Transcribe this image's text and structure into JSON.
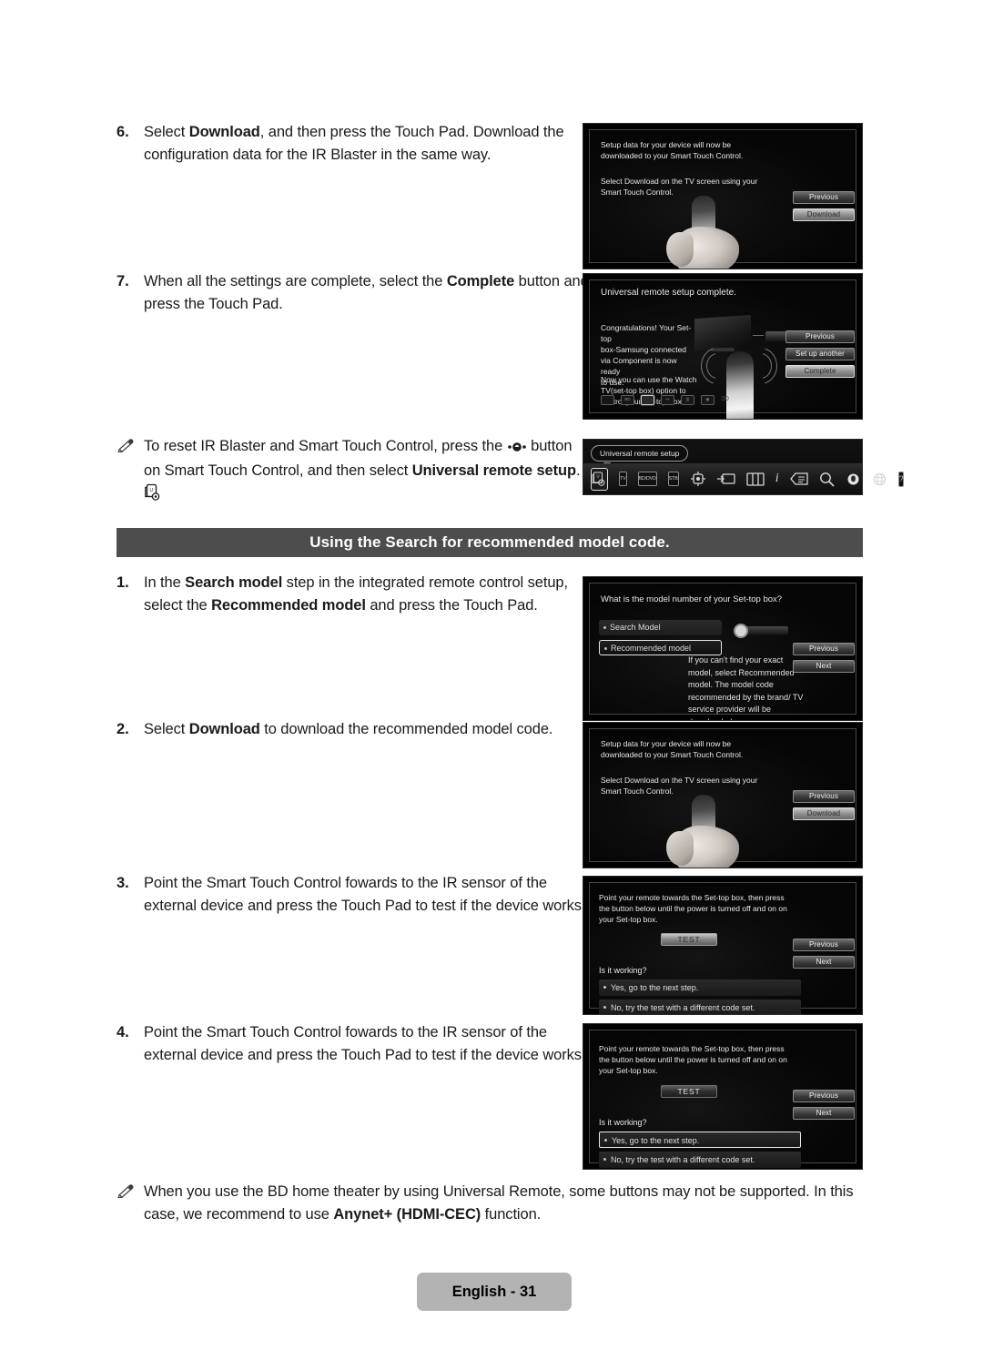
{
  "steps": {
    "s6": {
      "num": "6.",
      "p1": "Select ",
      "bold1": "Download",
      "p2": ", and then press the Touch Pad. Download the configuration data for the IR Blaster in the same way."
    },
    "s7": {
      "num": "7.",
      "p1": "When all the settings are complete, select the ",
      "bold1": "Complete",
      "p2": " button and press the Touch Pad."
    },
    "note1": {
      "p1": "To reset IR Blaster and Smart Touch Control, press the ",
      "icon1": "more-button-icon",
      "p2": " button on Smart Touch Control, and then select ",
      "bold1": "Universal remote setup",
      "p3": ".",
      "icon2": "universal-remote-setup-icon"
    },
    "s1": {
      "num": "1.",
      "p1": "In the ",
      "bold1": "Search model",
      "p2": " step in the integrated remote control setup, select the ",
      "bold2": "Recommended model",
      "p3": " and press the Touch Pad."
    },
    "s2": {
      "num": "2.",
      "p1": "Select ",
      "bold1": "Download",
      "p2": " to download the recommended model code."
    },
    "s3": {
      "num": "3.",
      "p1": "Point the Smart Touch Control fowards to the IR sensor of the external device and press the Touch Pad to test if the device works."
    },
    "s4": {
      "num": "4.",
      "p1": "Point the Smart Touch Control fowards to the IR sensor of the external device and press the Touch Pad to test if the device works."
    },
    "note2": {
      "p1": "When you use the BD home theater by using Universal Remote, some buttons may not be supported. In this case, we recommend to use ",
      "bold1": "Anynet+ (HDMI-CEC)",
      "p2": " function."
    }
  },
  "section_header": "Using the Search for recommended model code.",
  "footer": "English - 31",
  "shots": {
    "download1": {
      "line1": "Setup data for your device will now be",
      "line2": "downloaded to your Smart Touch Control.",
      "line3": "Select Download on the TV screen using your",
      "line4": "Smart Touch Control.",
      "btn_previous": "Previous",
      "btn_download": "Download"
    },
    "complete": {
      "title": "Universal remote setup complete.",
      "line1": "Congratulations! Your Set-top",
      "line2": "box-Samsung connected",
      "line3": "via Component is now ready",
      "line4": "to use.",
      "line5": "Now you can use the Watch",
      "line6": "TV(set-top box) option to",
      "line7": "control your set-top box",
      "btn_previous": "Previous",
      "btn_setup_another": "Set up another",
      "btn_complete": "Complete",
      "source_icons": [
        "tv-icon",
        "bd-dvd-icon",
        "set-top-box-icon",
        "source-input-icon",
        "channel-list-icon",
        "recording-icon"
      ],
      "badge_3d": "3D"
    },
    "menubar": {
      "tooltip": "Universal remote setup",
      "icons": [
        {
          "name": "universal-remote-setup-icon",
          "label": ""
        },
        {
          "name": "tv-icon",
          "label": "TV"
        },
        {
          "name": "bd-dvd-icon",
          "label": "BD/DVD"
        },
        {
          "name": "stb-icon",
          "label": "STB"
        },
        {
          "name": "smart-hub-icon",
          "label": ""
        },
        {
          "name": "source-icon",
          "label": ""
        },
        {
          "name": "channel-list-icon",
          "label": ""
        },
        {
          "name": "info-icon",
          "label": "i"
        },
        {
          "name": "guide-icon",
          "label": ""
        },
        {
          "name": "search-icon",
          "label": ""
        },
        {
          "name": "voice-icon",
          "label": ""
        },
        {
          "name": "web-browser-icon",
          "label": ""
        },
        {
          "name": "help-icon",
          "label": "?"
        }
      ]
    },
    "search_model": {
      "question": "What is the model number of your Set-top box?",
      "opt_search": "Search Model",
      "opt_recommended": "Recommended model",
      "hint": "If you can't find your exact model, select Recommended model. The model code recommended by the brand/ TV service provider will be downloaded.",
      "btn_previous": "Previous",
      "btn_next": "Next"
    },
    "download2": {
      "line1": "Setup data for your device will now be",
      "line2": "downloaded to your Smart Touch Control.",
      "line3": "Select Download on the TV screen using your",
      "line4": "Smart Touch Control.",
      "btn_previous": "Previous",
      "btn_download": "Download"
    },
    "test1": {
      "line1": "Point your remote towards the Set-top box, then press",
      "line2": "the button below until the power is turned off and on on",
      "line3": "your Set-top box.",
      "btn_test": "TEST",
      "question": "Is it working?",
      "ans_yes": "Yes, go to the next step.",
      "ans_no": "No, try the test with a different code set.",
      "btn_previous": "Previous",
      "btn_next": "Next"
    },
    "test2": {
      "line1": "Point your remote towards the Set-top box, then press",
      "line2": "the button below until the power is turned off and on on",
      "line3": "your Set-top box.",
      "btn_test": "TEST",
      "question": "Is it working?",
      "ans_yes": "Yes, go to the next step.",
      "ans_no": "No, try the test with a different code set.",
      "btn_previous": "Previous",
      "btn_next": "Next"
    }
  },
  "colors": {
    "section_bar": "#4d4d4d",
    "footer_bg": "#b3b3b3",
    "page_bg": "#ffffff",
    "text": "#1a1a1a"
  }
}
